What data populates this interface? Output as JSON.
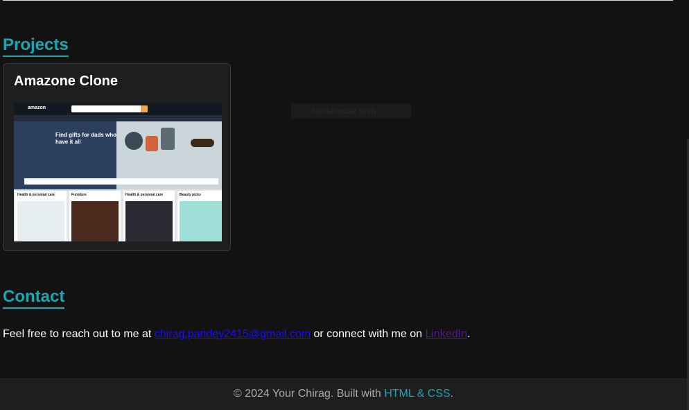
{
  "projects": {
    "title": "Projects",
    "items": [
      {
        "name": "Amazone Clone",
        "thumbnail": {
          "logo_text": "amazon",
          "hero_text": "Find gifts for dads who have it all",
          "cards": [
            "Health & personal care",
            "Furniture",
            "Health & personal care",
            "Beauty picks"
          ]
        }
      }
    ]
  },
  "ghost": {
    "label": "Rectangular Snip"
  },
  "contact": {
    "title": "Contact",
    "prefix": "Feel free to reach out to me at ",
    "email": "chirag.pandey2415@gmail.com",
    "middle": " or connect with me on ",
    "linkedin": "LinkedIn",
    "suffix": "."
  },
  "footer": {
    "prefix": "© 2024 Your Chirag. Built with ",
    "tech": "HTML & CSS",
    "suffix": "."
  },
  "colors": {
    "accent": "#1aa6b2",
    "background": "#121212",
    "card": "#1e1e1e"
  }
}
